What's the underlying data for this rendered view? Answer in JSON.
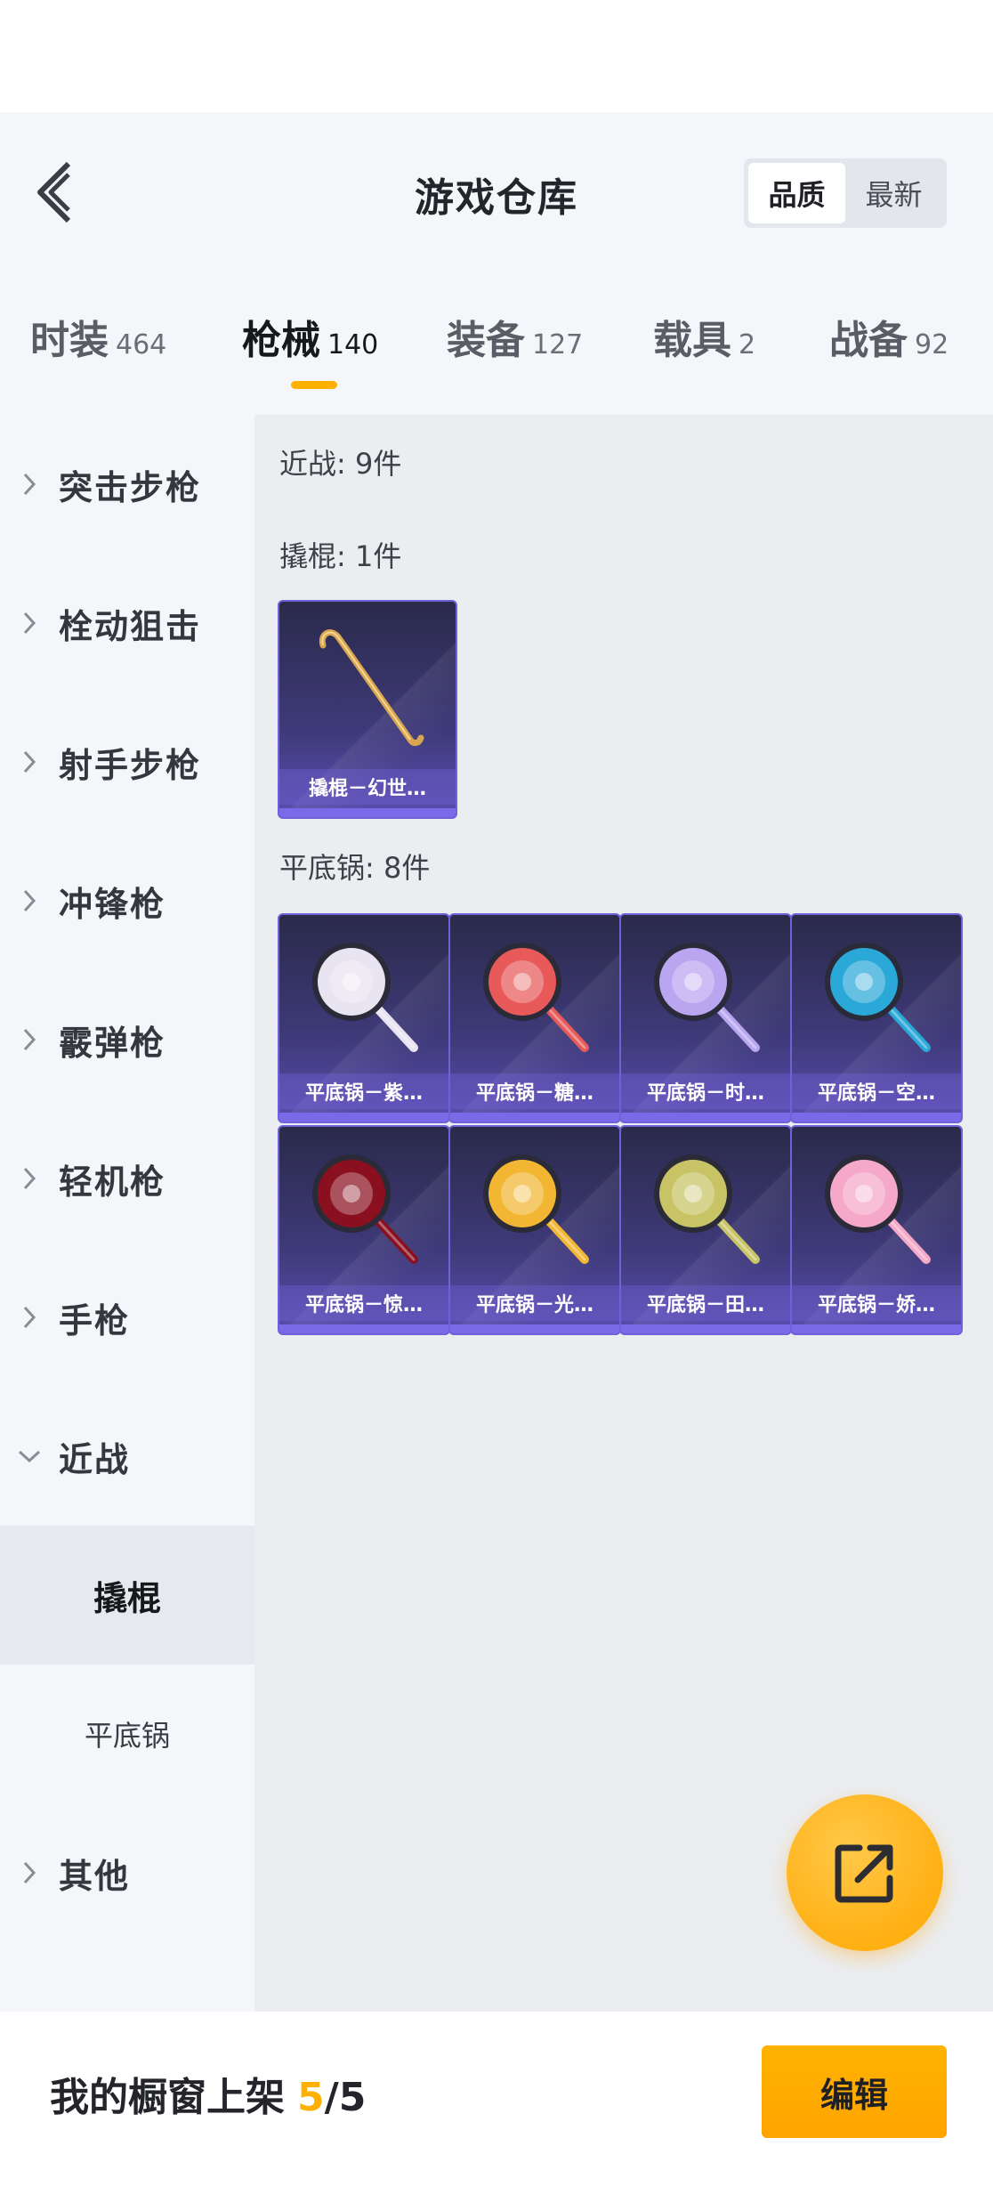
{
  "header": {
    "title": "游戏仓库",
    "sort_options": [
      "品质",
      "最新"
    ],
    "sort_selected": "品质"
  },
  "category_tabs": [
    {
      "label": "时装",
      "count": "464"
    },
    {
      "label": "枪械",
      "count": "140"
    },
    {
      "label": "装备",
      "count": "127"
    },
    {
      "label": "载具",
      "count": "2"
    },
    {
      "label": "战备",
      "count": "92"
    }
  ],
  "active_category": "枪械",
  "sidebar": {
    "items": [
      {
        "label": "突击步枪"
      },
      {
        "label": "栓动狙击"
      },
      {
        "label": "射手步枪"
      },
      {
        "label": "冲锋枪"
      },
      {
        "label": "霰弹枪"
      },
      {
        "label": "轻机枪"
      },
      {
        "label": "手枪"
      },
      {
        "label": "近战"
      },
      {
        "label": "其他"
      }
    ],
    "sub_items": [
      {
        "label": "撬棍"
      },
      {
        "label": "平底锅"
      }
    ],
    "expanded": "近战",
    "active_sub": "撬棍"
  },
  "content": {
    "section_melee": "近战: 9件",
    "section_crowbar": "撬棍: 1件",
    "section_pan": "平底锅: 8件",
    "crowbar_items": [
      {
        "name": "撬棍－幻世…",
        "icon": "crowbar-icon"
      }
    ],
    "pan_items": [
      {
        "name": "平底锅－紫…",
        "icon": "pan-icon",
        "color": "#e9e4f2"
      },
      {
        "name": "平底锅－糖…",
        "icon": "pan-icon",
        "color": "#e85a5a"
      },
      {
        "name": "平底锅－时…",
        "icon": "pan-icon",
        "color": "#b9a5f0"
      },
      {
        "name": "平底锅－空…",
        "icon": "pan-icon",
        "color": "#2aa8d8"
      },
      {
        "name": "平底锅－惊…",
        "icon": "pan-icon",
        "color": "#8a1020"
      },
      {
        "name": "平底锅－光…",
        "icon": "pan-icon",
        "color": "#f2b632"
      },
      {
        "name": "平底锅－田…",
        "icon": "pan-icon",
        "color": "#c8c466"
      },
      {
        "name": "平底锅－娇…",
        "icon": "pan-icon",
        "color": "#f5a8c8"
      }
    ]
  },
  "fab": {
    "icon": "share-external-icon"
  },
  "bottom_bar": {
    "shelf_label": "我的橱窗上架",
    "shelf_current": "5",
    "shelf_total": "/5",
    "edit_label": "编辑"
  },
  "colors": {
    "accent": "#ffb000",
    "card_border": "#6d62d8"
  }
}
